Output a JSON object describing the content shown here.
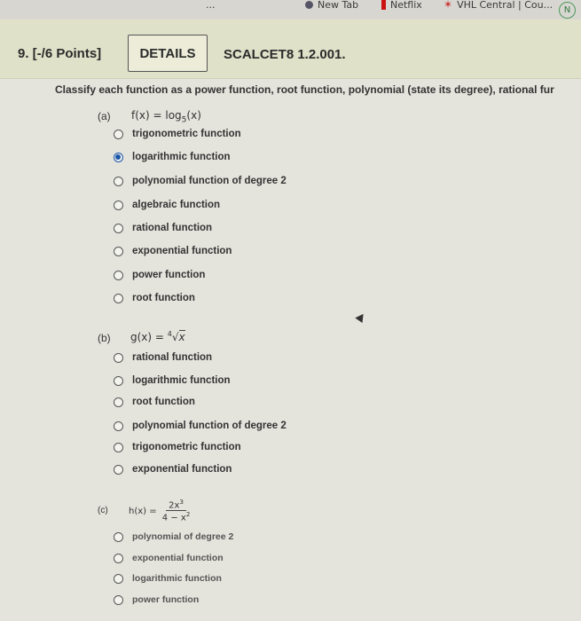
{
  "bookmarks": {
    "truncated_label": "...",
    "new_tab": "New Tab",
    "netflix": "Netflix",
    "vhl": "VHL Central | Cou...",
    "profile": "N"
  },
  "question": {
    "number": "9. [-/6 Points]",
    "details_button": "DETAILS",
    "code": "SCALCET8 1.2.001."
  },
  "instructions": "Classify each function as a power function, root function, polynomial (state its degree), rational fur",
  "parts": [
    {
      "label": "(a)",
      "function_lhs": "f(x) = log",
      "function_sub": "5",
      "function_rhs": "(x)",
      "options": [
        "trigonometric function",
        "logarithmic function",
        "polynomial function of degree 2",
        "algebraic function",
        "rational function",
        "exponential function",
        "power function",
        "root function"
      ],
      "selected": "logarithmic function"
    },
    {
      "label": "(b)",
      "function_lhs": "g(x) = ",
      "root_index": "4",
      "radicand": "x",
      "options": [
        "rational function",
        "logarithmic function",
        "root function",
        "polynomial function of degree 2",
        "trigonometric function",
        "exponential function"
      ]
    },
    {
      "label": "(c)",
      "function_lhs": "h(x) = ",
      "numerator": "2x",
      "numerator_exp": "3",
      "denominator": "4 − x",
      "denominator_exp": "2",
      "options": [
        "polynomial of degree 2",
        "exponential function",
        "logarithmic function",
        "power function"
      ]
    }
  ]
}
